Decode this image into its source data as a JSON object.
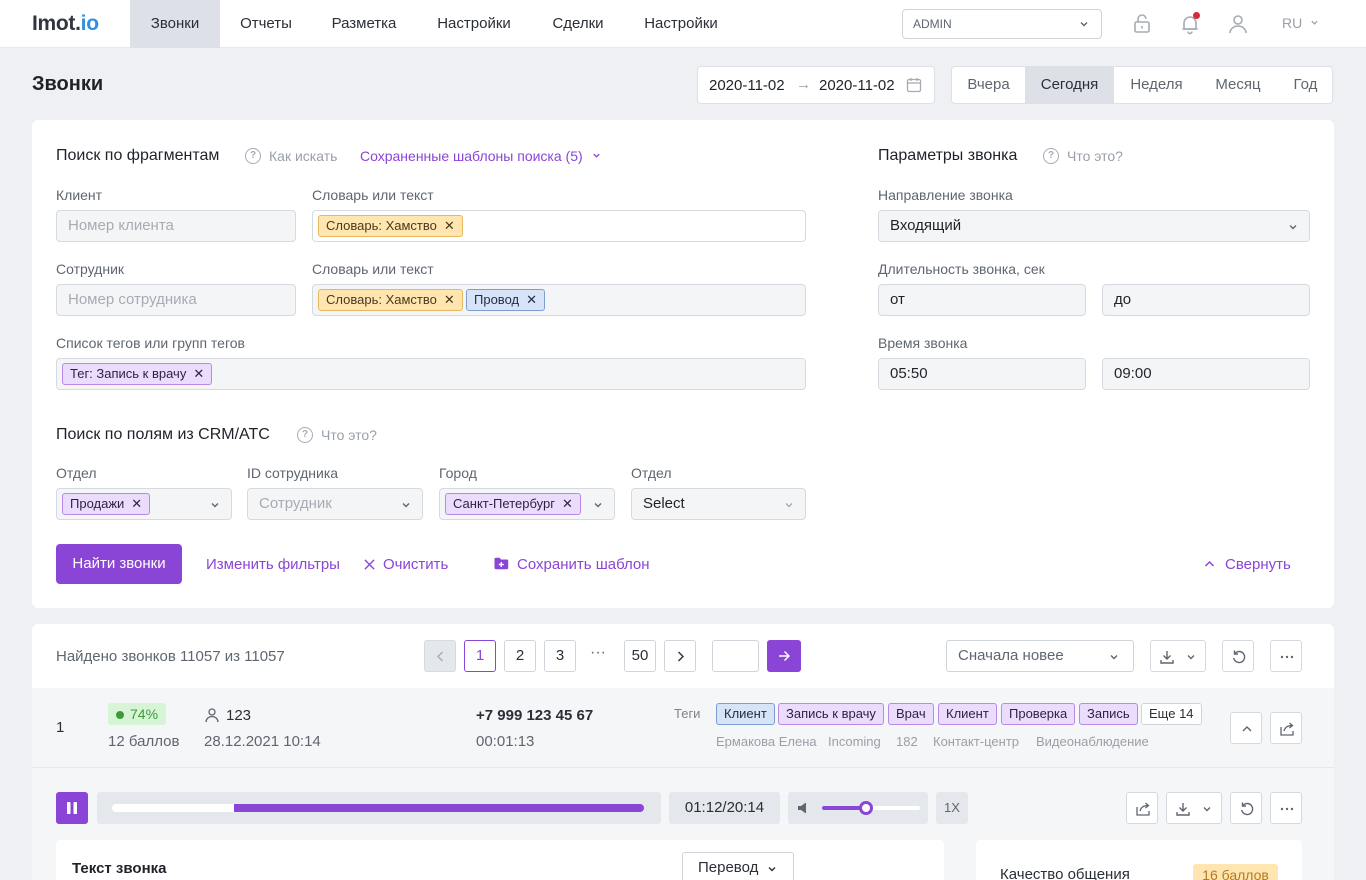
{
  "app": {
    "logo_main": "Imot.",
    "logo_accent": "io"
  },
  "nav": {
    "items": [
      {
        "label": "Звонки",
        "active": true
      },
      {
        "label": "Отчеты",
        "active": false
      },
      {
        "label": "Разметка",
        "active": false
      },
      {
        "label": "Настройки",
        "active": false
      },
      {
        "label": "Сделки",
        "active": false
      },
      {
        "label": "Настройки",
        "active": false
      }
    ],
    "role_select": "ADMIN",
    "language": "RU"
  },
  "page": {
    "title": "Звонки",
    "date_from": "2020-11-02",
    "date_to": "2020-11-02",
    "date_separator": "→",
    "periods": [
      {
        "label": "Вчера",
        "active": false
      },
      {
        "label": "Сегодня",
        "active": true
      },
      {
        "label": "Неделя",
        "active": false
      },
      {
        "label": "Месяц",
        "active": false
      },
      {
        "label": "Год",
        "active": false
      }
    ]
  },
  "fragments": {
    "title": "Поиск по фрагментам",
    "help_label": "Как искать",
    "saved_templates": "Сохраненные шаблоны поиска (5)",
    "client_label": "Клиент",
    "client_placeholder": "Номер клиента",
    "dict1_label": "Словарь или текст",
    "dict1_chips": [
      "Словарь: Хамство"
    ],
    "employee_label": "Сотрудник",
    "employee_placeholder": "Номер сотрудника",
    "dict2_label": "Словарь или текст",
    "dict2_chips": [
      "Словарь: Хамство",
      "Провод"
    ],
    "tags_label": "Список тегов или групп тегов",
    "tags_chips": [
      "Тег: Запись к врачу"
    ],
    "chip_remove": "✕"
  },
  "call_params": {
    "title": "Параметры звонка",
    "help_label": "Что это?",
    "direction_label": "Направление звонка",
    "direction_value": "Входящий",
    "duration_label": "Длительность звонка, сек",
    "duration_from": "от",
    "duration_to": "до",
    "time_label": "Время звонка",
    "time_from": "05:50",
    "time_to": "09:00"
  },
  "crm": {
    "title": "Поиск по полям из CRM/АТС",
    "help_label": "Что это?",
    "fields": [
      {
        "label": "Отдел",
        "chip": "Продажи"
      },
      {
        "label": "ID сотрудника",
        "placeholder": "Сотрудник"
      },
      {
        "label": "Город",
        "chip": "Санкт-Петербург"
      },
      {
        "label": "Отдел",
        "value": "Select"
      }
    ]
  },
  "actions": {
    "find": "Найти звонки",
    "change_filters": "Изменить фильтры",
    "clear": "Очистить",
    "save_template": "Сохранить шаблон",
    "collapse": "Свернуть"
  },
  "results": {
    "found_text": "Найдено звонков 11057 из 11057",
    "pages": [
      "1",
      "2",
      "3",
      "50"
    ],
    "current_page": "1",
    "dots": "···",
    "sort_value": "Сначала новее"
  },
  "call": {
    "number": "1",
    "score_percent": "74%",
    "score_points": "12 баллов",
    "employee_id": "123",
    "datetime": "28.12.2021 10:14",
    "phone": "+7 999 123 45 67",
    "duration": "00:01:13",
    "tags_label": "Теги",
    "tags": [
      {
        "label": "Клиент",
        "color": "blue"
      },
      {
        "label": "Запись к врачу",
        "color": "purple"
      },
      {
        "label": "Врач",
        "color": "purple"
      },
      {
        "label": "Клиент",
        "color": "purple"
      },
      {
        "label": "Проверка",
        "color": "purple"
      },
      {
        "label": "Запись",
        "color": "purple"
      },
      {
        "label": "Еще 14",
        "color": "plain"
      }
    ],
    "meta": [
      "Ермакова Елена",
      "Incoming",
      "182",
      "Контакт-центр",
      "Видеонаблюдение"
    ]
  },
  "player": {
    "time": "01:12/20:14",
    "speed": "1X",
    "progress": 0.23,
    "volume": 0.45
  },
  "transcript": {
    "title": "Текст звонка",
    "translate": "Перевод"
  },
  "quality": {
    "title": "Качество общения",
    "badge": "16 баллов"
  },
  "colors": {
    "accent": "#8b45d6",
    "score_green": "#3e9a3b",
    "logo_blue": "#2f8fe0"
  }
}
